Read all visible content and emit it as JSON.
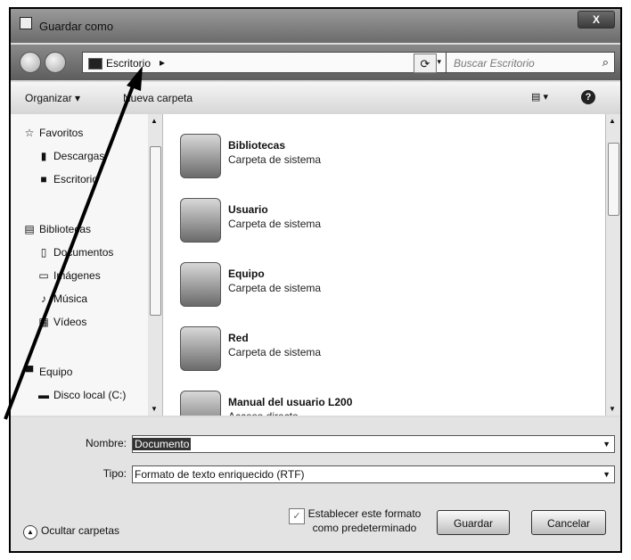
{
  "window": {
    "title": "Guardar como",
    "close_label": "X"
  },
  "address": {
    "location": "Escritorio",
    "separator": "▸",
    "dropdown": "▾",
    "refresh": "⟳"
  },
  "search": {
    "placeholder": "Buscar Escritorio",
    "icon": "search-icon"
  },
  "toolbar": {
    "organize": "Organizar ▾",
    "new_folder": "Nueva carpeta",
    "view": "▤ ▾",
    "help": "?"
  },
  "sidebar": {
    "items": [
      {
        "label": "Favoritos",
        "icon": "☆"
      },
      {
        "label": "Descargas",
        "icon": "▮"
      },
      {
        "label": "Escritorio",
        "icon": "■"
      },
      {
        "label": "Bibliotecas",
        "icon": "▤"
      },
      {
        "label": "Documentos",
        "icon": "▯"
      },
      {
        "label": "Imágenes",
        "icon": "▭"
      },
      {
        "label": "Música",
        "icon": "♪"
      },
      {
        "label": "Vídeos",
        "icon": "▦"
      },
      {
        "label": "Equipo",
        "icon": "▀"
      },
      {
        "label": "Disco local (C:)",
        "icon": "▬"
      }
    ]
  },
  "files": [
    {
      "name": "Bibliotecas",
      "type": "Carpeta de sistema"
    },
    {
      "name": "Usuario",
      "type": "Carpeta de sistema"
    },
    {
      "name": "Equipo",
      "type": "Carpeta de sistema"
    },
    {
      "name": "Red",
      "type": "Carpeta de sistema"
    },
    {
      "name": "Manual del usuario L200",
      "type": "Acceso directo"
    }
  ],
  "form": {
    "name_label": "Nombre:",
    "name_value": "Documento",
    "type_label": "Tipo:",
    "type_value": "Formato de texto enriquecido (RTF)"
  },
  "footer": {
    "hide_folders": "Ocultar carpetas",
    "default_format": "Establecer este formato como predeterminado",
    "checkmark": "✓",
    "save": "Guardar",
    "cancel": "Cancelar"
  }
}
